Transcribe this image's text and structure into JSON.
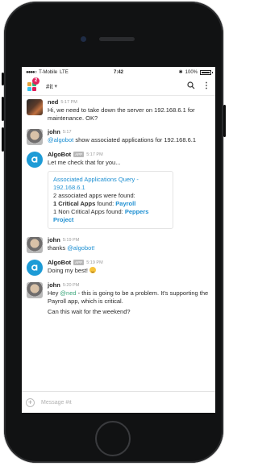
{
  "status_bar": {
    "carrier": "T-Mobile",
    "network": "LTE",
    "time": "7:42",
    "battery": "100%",
    "battery_level": 1.0
  },
  "header": {
    "badge_count": "2",
    "channel": "#it",
    "caret": "▾"
  },
  "messages": [
    {
      "author": "ned",
      "time": "5:17 PM",
      "text": "Hi, we need to take down the server on 192.168.6.1 for maintenance. OK?"
    },
    {
      "author": "john",
      "time": "5:17",
      "mention": "@algobot",
      "text": " show associated applications for 192.168.6.1"
    },
    {
      "author": "AlgoBot",
      "app_tag": "APP",
      "time": "5:17 PM",
      "text": "Let me check that for you...",
      "attachment": {
        "title": "Associated Applications Query - 192.168.6.1",
        "line1": "2 associated apps were found:",
        "line2_prefix": "1 Critical Apps",
        "line2_middle": " found: ",
        "line2_link": "Payroll",
        "line3_prefix": "1 Non Critical Apps found: ",
        "line3_link": "Peppers Project"
      }
    },
    {
      "author": "john",
      "time": "5:19 PM",
      "text_prefix": "thanks ",
      "mention": "@algobot!"
    },
    {
      "author": "AlgoBot",
      "app_tag": "APP",
      "time": "5:19 PM",
      "text": "Doing my best! "
    },
    {
      "author": "john",
      "time": "5:20 PM",
      "text_prefix": "Hey ",
      "mention": "@ned",
      "text": " - this is going to be a problem. It's supporting the Payroll app, which is critical.",
      "text2": "Can this wait for the weekend?"
    }
  ],
  "composer": {
    "placeholder": "Message #it"
  },
  "colors": {
    "accent": "#1d8fd2",
    "badge": "#e0245e",
    "bot": "#1d9bd6",
    "mention_green": "#3aa67a"
  },
  "icons": [
    "search-icon",
    "more-vertical-icon",
    "algobot-icon",
    "add-icon",
    "team-logo-icon"
  ]
}
